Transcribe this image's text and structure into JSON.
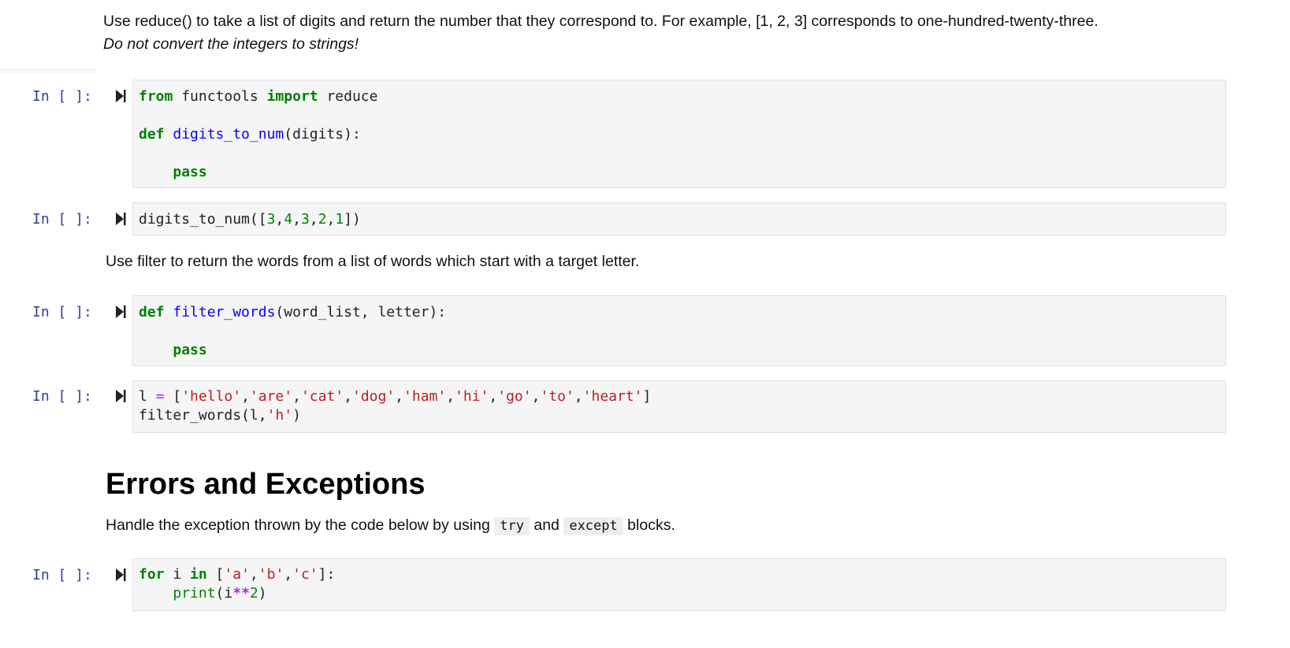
{
  "notebook": {
    "prompt_label": "In [ ]:",
    "colors": {
      "prompt": "#303F9F",
      "keyword": "#008000",
      "function_name": "#0000ff",
      "number": "#008000",
      "string": "#ba2121",
      "operator": "#aa22ff",
      "cell_background": "#f5f5f5",
      "cell_border": "#e0e0e0"
    },
    "markdown_1": {
      "line1": "Use reduce() to take a list of digits and return the number that they correspond to. For example, [1, 2, 3] corresponds to one-hundred-twenty-three.",
      "line2": "Do not convert the integers to strings!"
    },
    "cell_1": {
      "prompt": "In [ ]:",
      "line1": {
        "kw1": "from",
        "t1": " functools ",
        "kw2": "import",
        "t2": " reduce"
      },
      "line3": {
        "kw": "def",
        "sp": " ",
        "fn": "digits_to_num",
        "rest": "(digits):"
      },
      "line5": {
        "indent": "    ",
        "kw": "pass"
      }
    },
    "cell_2": {
      "prompt": "In [ ]:",
      "call": "digits_to_num([",
      "digits": [
        "3",
        "4",
        "3",
        "2",
        "1"
      ],
      "close": "])"
    },
    "markdown_2": {
      "text": "Use filter to return the words from a list of words which start with a target letter."
    },
    "cell_3": {
      "prompt": "In [ ]:",
      "line1": {
        "kw": "def",
        "sp": " ",
        "fn": "filter_words",
        "rest": "(word_list, letter):"
      },
      "line3": {
        "indent": "    ",
        "kw": "pass"
      }
    },
    "cell_4": {
      "prompt": "In [ ]:",
      "var": "l",
      "assign": "=",
      "words": [
        "'hello'",
        "'are'",
        "'cat'",
        "'dog'",
        "'ham'",
        "'hi'",
        "'go'",
        "'to'",
        "'heart'"
      ],
      "call": "filter_words(l,",
      "arg": "'h'",
      "close": ")"
    },
    "heading": {
      "text": "Errors and Exceptions"
    },
    "markdown_3": {
      "before": "Handle the exception thrown by the code below by using ",
      "code1": "try",
      "middle": " and ",
      "code2": "except",
      "after": " blocks."
    },
    "cell_5": {
      "prompt": "In [ ]:",
      "line1": {
        "kw1": "for",
        "t1": " i ",
        "kw2": "in",
        "t2": " [",
        "s1": "'a'",
        "s2": "'b'",
        "s3": "'c'",
        "end": "]:"
      },
      "line2": {
        "indent": "    ",
        "bi": "print",
        "open": "(i",
        "op": "**",
        "num": "2",
        "close": ")"
      }
    }
  }
}
